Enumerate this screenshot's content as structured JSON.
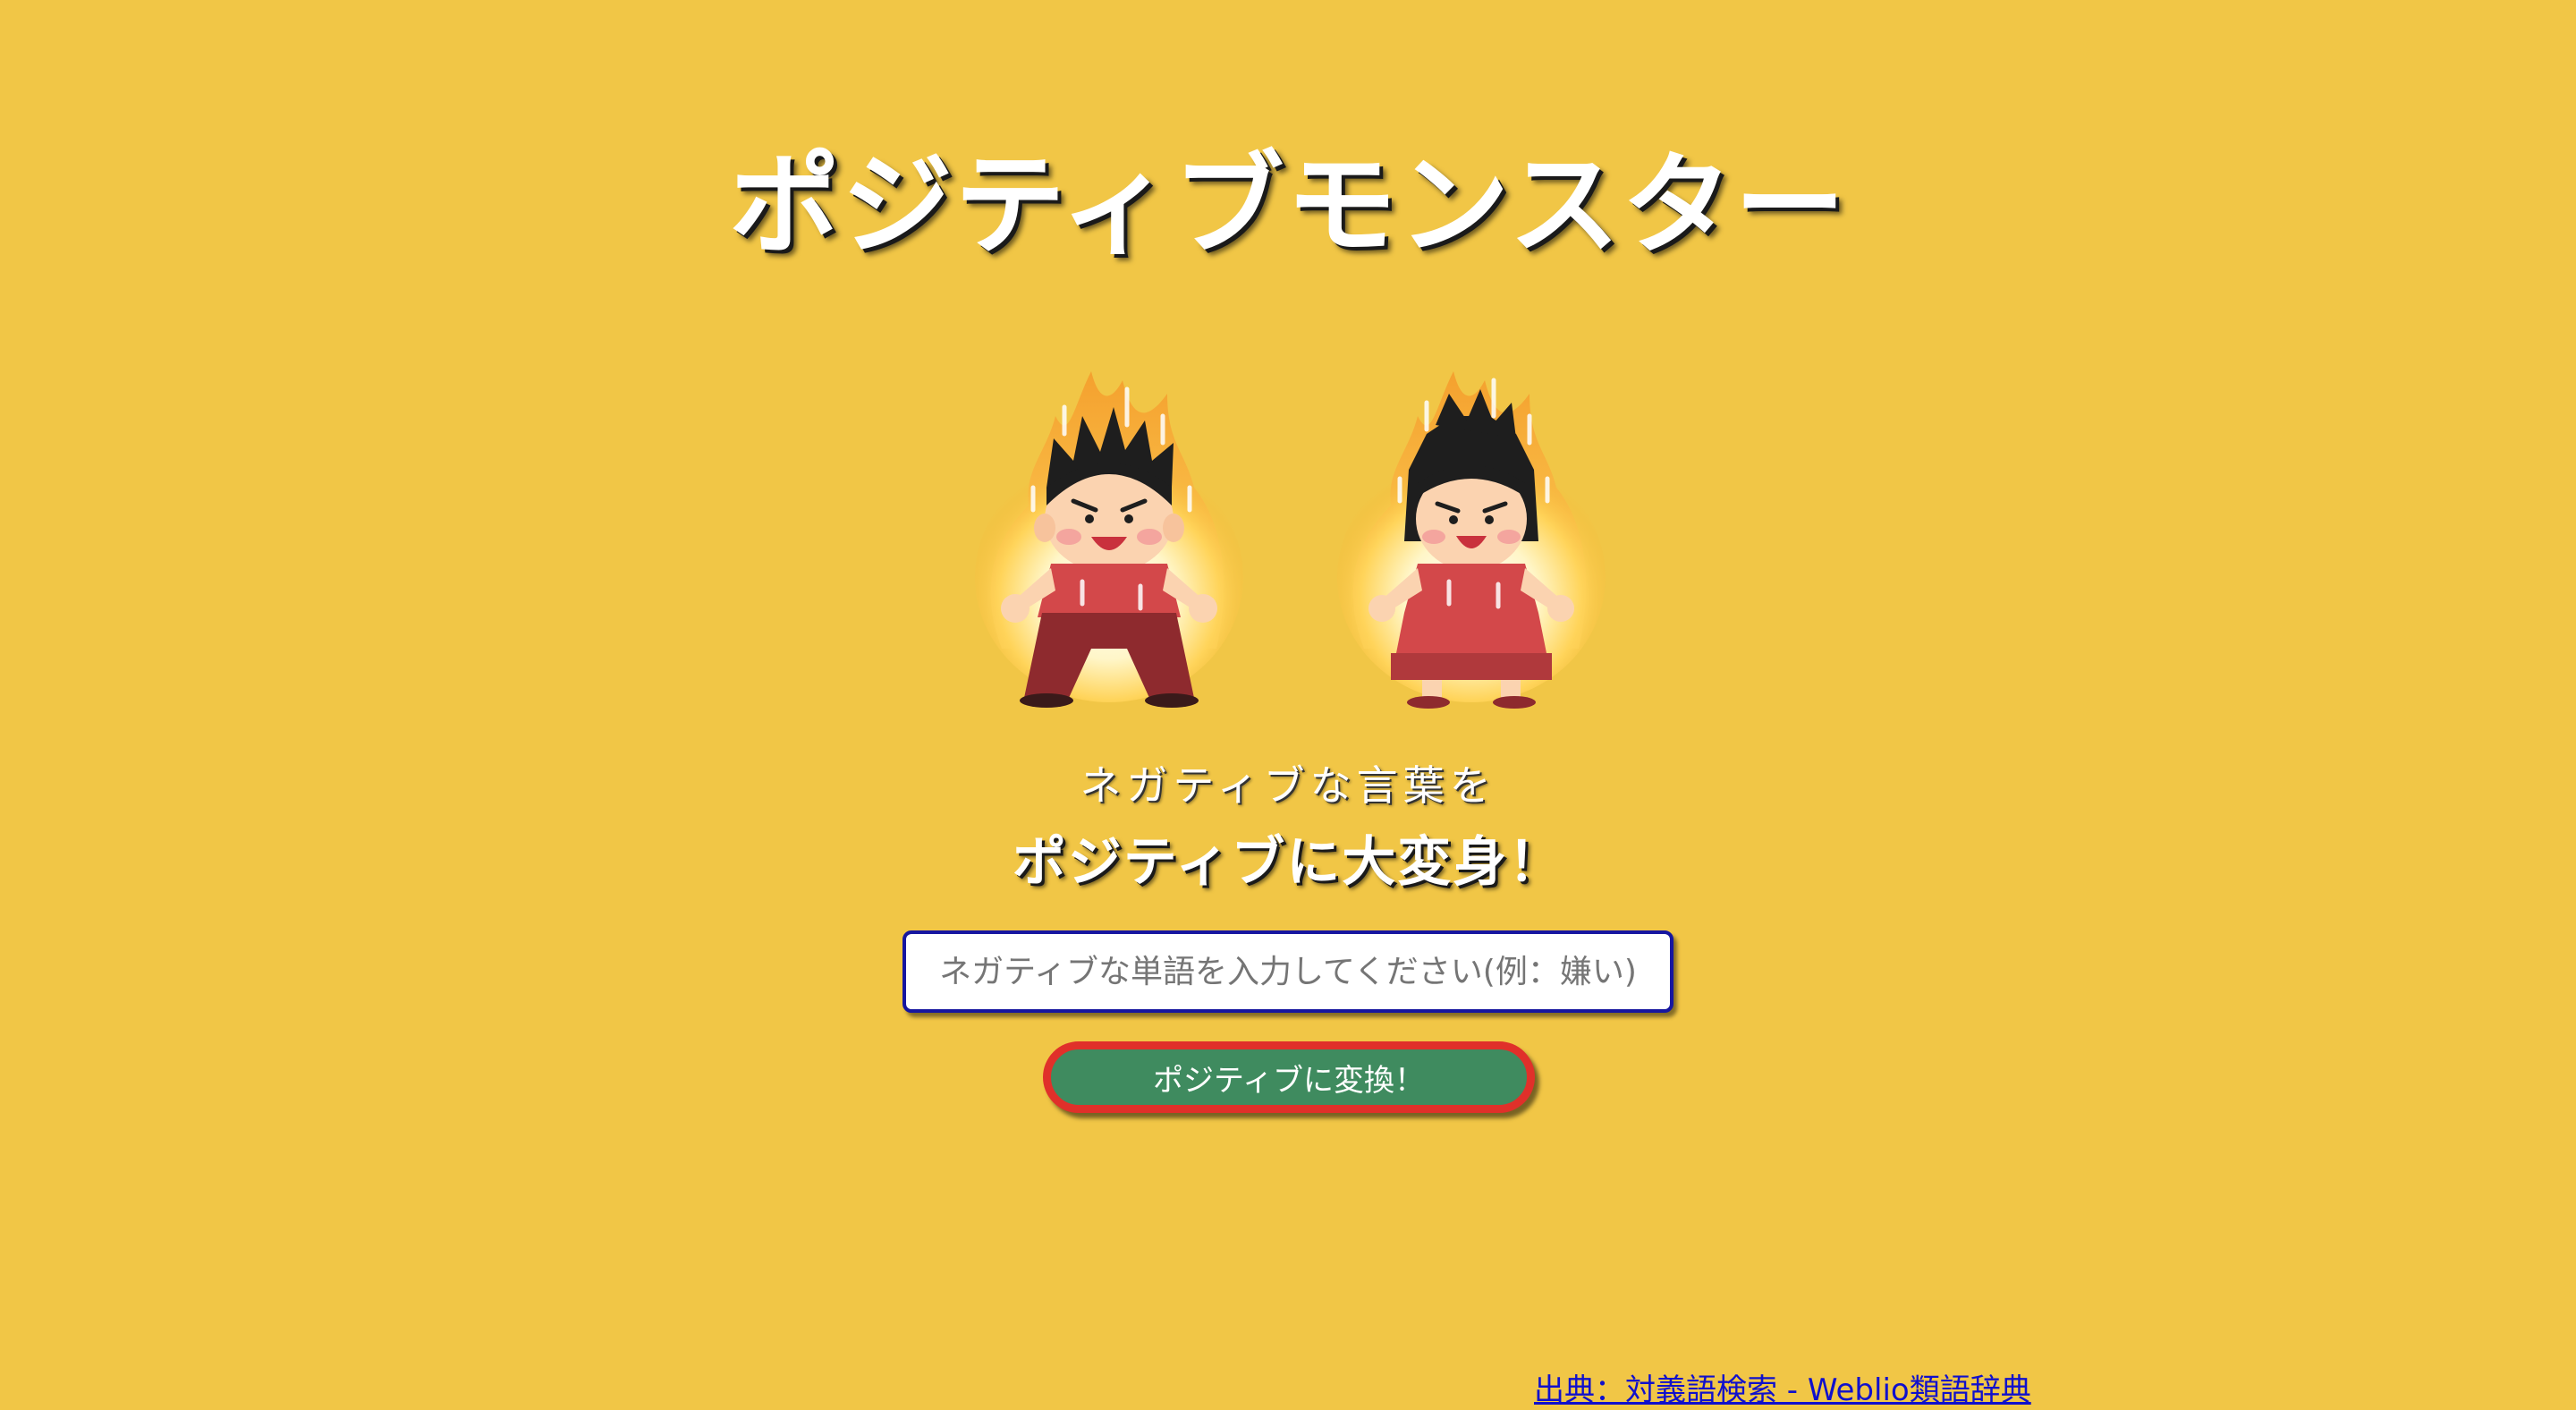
{
  "header": {
    "title": "ポジティブモンスター"
  },
  "hero_images": [
    {
      "icon": "flaming-boy-illustration"
    },
    {
      "icon": "flaming-girl-illustration"
    }
  ],
  "tagline": {
    "line1": "ネガティブな言葉を",
    "line2": "ポジティブに大変身！"
  },
  "form": {
    "input_value": "",
    "input_placeholder": "ネガティブな単語を入力してください(例：嫌い)",
    "submit_label": "ポジティブに変換！"
  },
  "footer": {
    "source_label": "出典：対義語検索 - Weblio類語辞典"
  },
  "colors": {
    "background": "#f1c646",
    "input_border": "#1616a0",
    "button_fill": "#3f8b5f",
    "button_border": "#e0302a",
    "link": "#1010cc"
  }
}
